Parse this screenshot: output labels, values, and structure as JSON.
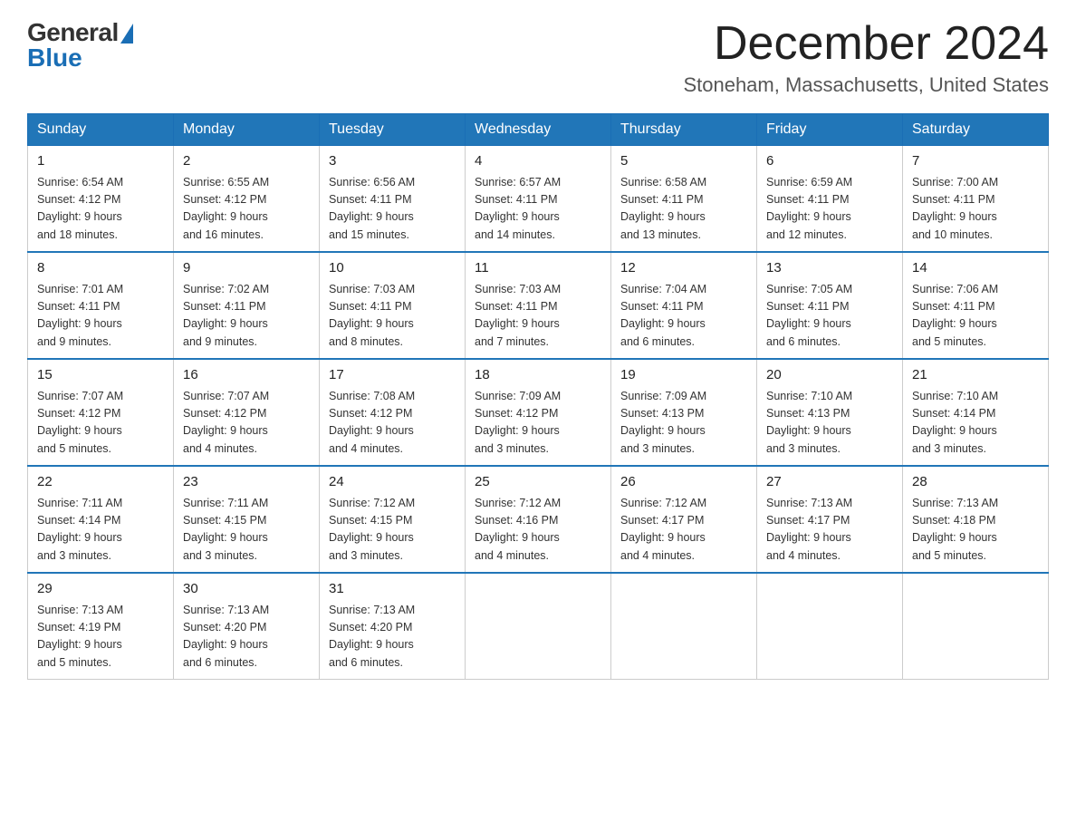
{
  "logo": {
    "general": "General",
    "blue": "Blue"
  },
  "title": {
    "month": "December 2024",
    "location": "Stoneham, Massachusetts, United States"
  },
  "weekdays": [
    "Sunday",
    "Monday",
    "Tuesday",
    "Wednesday",
    "Thursday",
    "Friday",
    "Saturday"
  ],
  "weeks": [
    [
      {
        "day": "1",
        "sunrise": "6:54 AM",
        "sunset": "4:12 PM",
        "daylight": "9 hours and 18 minutes."
      },
      {
        "day": "2",
        "sunrise": "6:55 AM",
        "sunset": "4:12 PM",
        "daylight": "9 hours and 16 minutes."
      },
      {
        "day": "3",
        "sunrise": "6:56 AM",
        "sunset": "4:11 PM",
        "daylight": "9 hours and 15 minutes."
      },
      {
        "day": "4",
        "sunrise": "6:57 AM",
        "sunset": "4:11 PM",
        "daylight": "9 hours and 14 minutes."
      },
      {
        "day": "5",
        "sunrise": "6:58 AM",
        "sunset": "4:11 PM",
        "daylight": "9 hours and 13 minutes."
      },
      {
        "day": "6",
        "sunrise": "6:59 AM",
        "sunset": "4:11 PM",
        "daylight": "9 hours and 12 minutes."
      },
      {
        "day": "7",
        "sunrise": "7:00 AM",
        "sunset": "4:11 PM",
        "daylight": "9 hours and 10 minutes."
      }
    ],
    [
      {
        "day": "8",
        "sunrise": "7:01 AM",
        "sunset": "4:11 PM",
        "daylight": "9 hours and 9 minutes."
      },
      {
        "day": "9",
        "sunrise": "7:02 AM",
        "sunset": "4:11 PM",
        "daylight": "9 hours and 9 minutes."
      },
      {
        "day": "10",
        "sunrise": "7:03 AM",
        "sunset": "4:11 PM",
        "daylight": "9 hours and 8 minutes."
      },
      {
        "day": "11",
        "sunrise": "7:03 AM",
        "sunset": "4:11 PM",
        "daylight": "9 hours and 7 minutes."
      },
      {
        "day": "12",
        "sunrise": "7:04 AM",
        "sunset": "4:11 PM",
        "daylight": "9 hours and 6 minutes."
      },
      {
        "day": "13",
        "sunrise": "7:05 AM",
        "sunset": "4:11 PM",
        "daylight": "9 hours and 6 minutes."
      },
      {
        "day": "14",
        "sunrise": "7:06 AM",
        "sunset": "4:11 PM",
        "daylight": "9 hours and 5 minutes."
      }
    ],
    [
      {
        "day": "15",
        "sunrise": "7:07 AM",
        "sunset": "4:12 PM",
        "daylight": "9 hours and 5 minutes."
      },
      {
        "day": "16",
        "sunrise": "7:07 AM",
        "sunset": "4:12 PM",
        "daylight": "9 hours and 4 minutes."
      },
      {
        "day": "17",
        "sunrise": "7:08 AM",
        "sunset": "4:12 PM",
        "daylight": "9 hours and 4 minutes."
      },
      {
        "day": "18",
        "sunrise": "7:09 AM",
        "sunset": "4:12 PM",
        "daylight": "9 hours and 3 minutes."
      },
      {
        "day": "19",
        "sunrise": "7:09 AM",
        "sunset": "4:13 PM",
        "daylight": "9 hours and 3 minutes."
      },
      {
        "day": "20",
        "sunrise": "7:10 AM",
        "sunset": "4:13 PM",
        "daylight": "9 hours and 3 minutes."
      },
      {
        "day": "21",
        "sunrise": "7:10 AM",
        "sunset": "4:14 PM",
        "daylight": "9 hours and 3 minutes."
      }
    ],
    [
      {
        "day": "22",
        "sunrise": "7:11 AM",
        "sunset": "4:14 PM",
        "daylight": "9 hours and 3 minutes."
      },
      {
        "day": "23",
        "sunrise": "7:11 AM",
        "sunset": "4:15 PM",
        "daylight": "9 hours and 3 minutes."
      },
      {
        "day": "24",
        "sunrise": "7:12 AM",
        "sunset": "4:15 PM",
        "daylight": "9 hours and 3 minutes."
      },
      {
        "day": "25",
        "sunrise": "7:12 AM",
        "sunset": "4:16 PM",
        "daylight": "9 hours and 4 minutes."
      },
      {
        "day": "26",
        "sunrise": "7:12 AM",
        "sunset": "4:17 PM",
        "daylight": "9 hours and 4 minutes."
      },
      {
        "day": "27",
        "sunrise": "7:13 AM",
        "sunset": "4:17 PM",
        "daylight": "9 hours and 4 minutes."
      },
      {
        "day": "28",
        "sunrise": "7:13 AM",
        "sunset": "4:18 PM",
        "daylight": "9 hours and 5 minutes."
      }
    ],
    [
      {
        "day": "29",
        "sunrise": "7:13 AM",
        "sunset": "4:19 PM",
        "daylight": "9 hours and 5 minutes."
      },
      {
        "day": "30",
        "sunrise": "7:13 AM",
        "sunset": "4:20 PM",
        "daylight": "9 hours and 6 minutes."
      },
      {
        "day": "31",
        "sunrise": "7:13 AM",
        "sunset": "4:20 PM",
        "daylight": "9 hours and 6 minutes."
      },
      null,
      null,
      null,
      null
    ]
  ],
  "labels": {
    "sunrise": "Sunrise:",
    "sunset": "Sunset:",
    "daylight": "Daylight: 9 hours"
  }
}
